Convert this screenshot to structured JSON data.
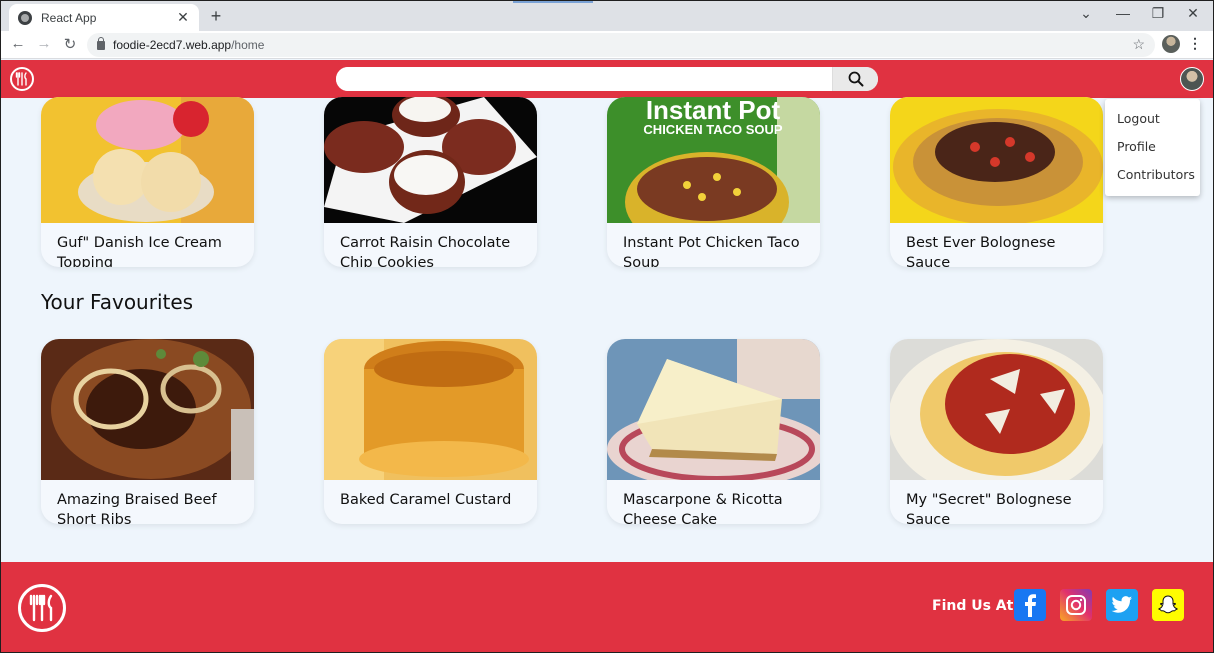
{
  "browser": {
    "tab_title": "React App",
    "url_host": "foodie-2ecd7.web.app",
    "url_path": "/home"
  },
  "search": {
    "placeholder": "",
    "value": ""
  },
  "dropdown": {
    "items": [
      "Logout",
      "Profile",
      "Contributors"
    ]
  },
  "top_row": [
    {
      "title": "Guf\" Danish Ice Cream Topping"
    },
    {
      "title": "Carrot Raisin Chocolate Chip Cookies"
    },
    {
      "title": "Instant Pot Chicken Taco Soup"
    },
    {
      "title": "Best Ever Bolognese Sauce"
    }
  ],
  "favourites": {
    "heading": "Your Favourites",
    "items": [
      {
        "title": "Amazing Braised Beef Short Ribs"
      },
      {
        "title": "Baked Caramel Custard"
      },
      {
        "title": "Mascarpone & Ricotta Cheese Cake"
      },
      {
        "title": "My \"Secret\" Bolognese Sauce"
      }
    ]
  },
  "image_text": {
    "instant_pot": "Instant Pot",
    "chicken_taco_soup": "CHICKEN TACO SOUP"
  },
  "footer": {
    "find_us": "Find Us At",
    "social": [
      "facebook-icon",
      "instagram-icon",
      "twitter-icon",
      "snapchat-icon"
    ]
  },
  "colors": {
    "brand_red": "#e03241",
    "page_bg": "#eef5fc",
    "facebook": "#1877f2",
    "twitter": "#1da1f2",
    "snapchat": "#fffc00"
  }
}
